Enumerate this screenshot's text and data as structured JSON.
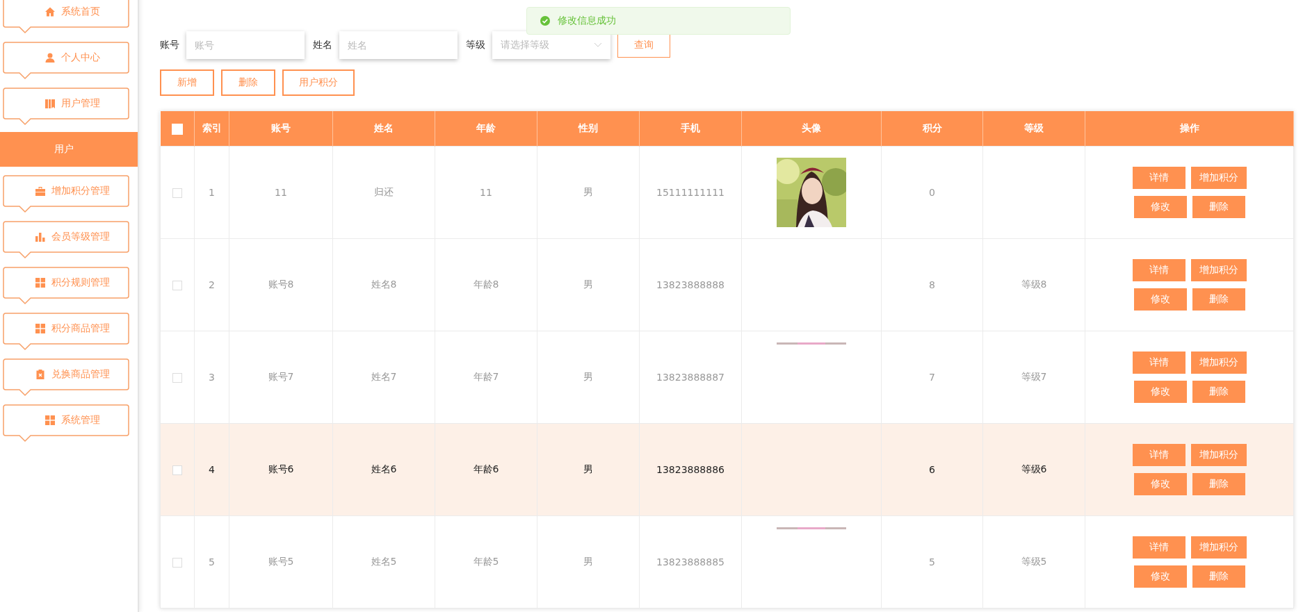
{
  "sidebar": {
    "items": [
      {
        "label": "系统首页",
        "selected": false
      },
      {
        "label": "个人中心",
        "selected": false
      },
      {
        "label": "用户管理",
        "selected": false,
        "children": [
          {
            "label": "用户",
            "selected": true
          }
        ]
      },
      {
        "label": "增加积分管理",
        "selected": false
      },
      {
        "label": "会员等级管理",
        "selected": false
      },
      {
        "label": "积分规则管理",
        "selected": false
      },
      {
        "label": "积分商品管理",
        "selected": false
      },
      {
        "label": "兑换商品管理",
        "selected": false
      },
      {
        "label": "系统管理",
        "selected": false
      }
    ]
  },
  "toast": {
    "message": "修改信息成功"
  },
  "search": {
    "fields": [
      {
        "label": "账号",
        "placeholder": "账号",
        "kind": "text"
      },
      {
        "label": "姓名",
        "placeholder": "姓名",
        "kind": "text"
      },
      {
        "label": "等级",
        "placeholder": "请选择等级",
        "kind": "select"
      }
    ],
    "button": "查询"
  },
  "toolbar": [
    "新增",
    "删除",
    "用户积分"
  ],
  "table": {
    "all_checked": false,
    "columns": [
      "索引",
      "账号",
      "姓名",
      "年龄",
      "性别",
      "手机",
      "头像",
      "积分",
      "等级",
      "操作"
    ],
    "rows": [
      {
        "index": "1",
        "account": "11",
        "name": "归还",
        "age": "11",
        "gender": "男",
        "phone": "15111111111",
        "photo": {
          "kind": "picture",
          "loaded": true
        },
        "points": "0",
        "checked": false,
        "hovered": false,
        "actions": [
          "详情",
          "增加积分",
          "修改",
          "删除"
        ]
      },
      {
        "index": "2",
        "account": "账号8",
        "name": "姓名8",
        "age": "年龄8",
        "gender": "男",
        "phone": "13823888888",
        "points": "8",
        "level": "等级8",
        "checked": false,
        "hovered": false,
        "actions": [
          "详情",
          "增加积分",
          "修改",
          "删除"
        ]
      },
      {
        "index": "3",
        "account": "账号7",
        "name": "姓名7",
        "age": "年龄7",
        "gender": "男",
        "phone": "13823888887",
        "photo": {
          "kind": "picture",
          "loaded": false
        },
        "points": "7",
        "level": "等级7",
        "checked": false,
        "hovered": false,
        "actions": [
          "详情",
          "增加积分",
          "修改",
          "删除"
        ]
      },
      {
        "index": "4",
        "account": "账号6",
        "name": "姓名6",
        "age": "年龄6",
        "gender": "男",
        "phone": "13823888886",
        "points": "6",
        "level": "等级6",
        "checked": false,
        "hovered": true,
        "actions": [
          "详情",
          "增加积分",
          "修改",
          "删除"
        ]
      },
      {
        "index": "5",
        "account": "账号5",
        "name": "姓名5",
        "age": "年龄5",
        "gender": "男",
        "phone": "13823888885",
        "photo": {
          "kind": "picture",
          "loaded": false
        },
        "points": "5",
        "level": "等级5",
        "checked": false,
        "hovered": false,
        "actions": [
          "详情",
          "增加积分",
          "修改",
          "删除"
        ]
      }
    ]
  }
}
